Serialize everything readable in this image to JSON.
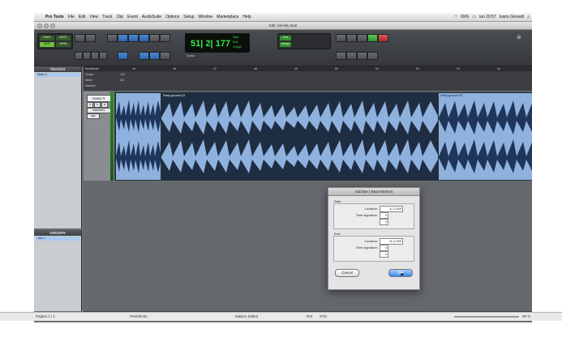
{
  "menubar": {
    "app_name": "Pro Tools",
    "items": [
      "File",
      "Edit",
      "View",
      "Track",
      "Clip",
      "Event",
      "AudioSuite",
      "Options",
      "Setup",
      "Window",
      "Marketplace",
      "Help"
    ],
    "battery": "69%",
    "clock": "lun 20:57",
    "user": "Ivano Giovedi"
  },
  "window": {
    "title": "Edit: Identify beat"
  },
  "toolbar": {
    "counter_main": "51| 2| 177",
    "start_label": "Start",
    "end_label": "End",
    "length_label": "Length",
    "cursor_label": "Cursor",
    "nudge_label": "Nudge",
    "grid_label": "Grid"
  },
  "tracks_panel": {
    "title": "TRACKS",
    "rows": [
      "Deep G"
    ]
  },
  "groups_panel": {
    "title": "GROUPS",
    "rows": [
      "<ALL>"
    ]
  },
  "rulers": {
    "rows": [
      "Bars|Beats",
      "Tempo",
      "Meter",
      "Markers"
    ],
    "bar_numbers": [
      "45",
      "46",
      "47",
      "48",
      "49",
      "50",
      "51",
      "52",
      "53",
      "54"
    ],
    "tempo_value": "120",
    "meter_value": "4/4"
  },
  "track": {
    "name": "Deep G",
    "buttons": [
      "R",
      "S",
      "M"
    ],
    "mode": "waveform",
    "mode2": "dyn"
  },
  "clips": [
    {
      "name": "Deep groove-01",
      "style": "dark"
    },
    {
      "name": "Deep groove-02",
      "style": "light"
    }
  ],
  "dialog": {
    "title": "Add Bar | Beat Markers",
    "start_heading": "Start",
    "end_heading": "End",
    "location_label": "Location:",
    "timesig_label": "Time signature:",
    "start_location": "1| 1| 000",
    "start_timesig_top": "4",
    "start_timesig_bottom": "4",
    "end_location": "9| 1| 000",
    "end_timesig_top": "4",
    "end_timesig_bottom": "4",
    "cancel_label": "Cancel",
    "ok_label": "OK"
  },
  "statusbar": {
    "page": "Pagina 1 / 1",
    "style": "Predefinito",
    "language": "Italiano (Italia)",
    "ins": "INS",
    "std": "STD",
    "zoom": "90 %"
  },
  "colors": {
    "counter_text": "#38e84a",
    "clip_light": "#8fb1de",
    "clip_dark": "#1f2d42",
    "ok_button": "#3c86e6"
  }
}
